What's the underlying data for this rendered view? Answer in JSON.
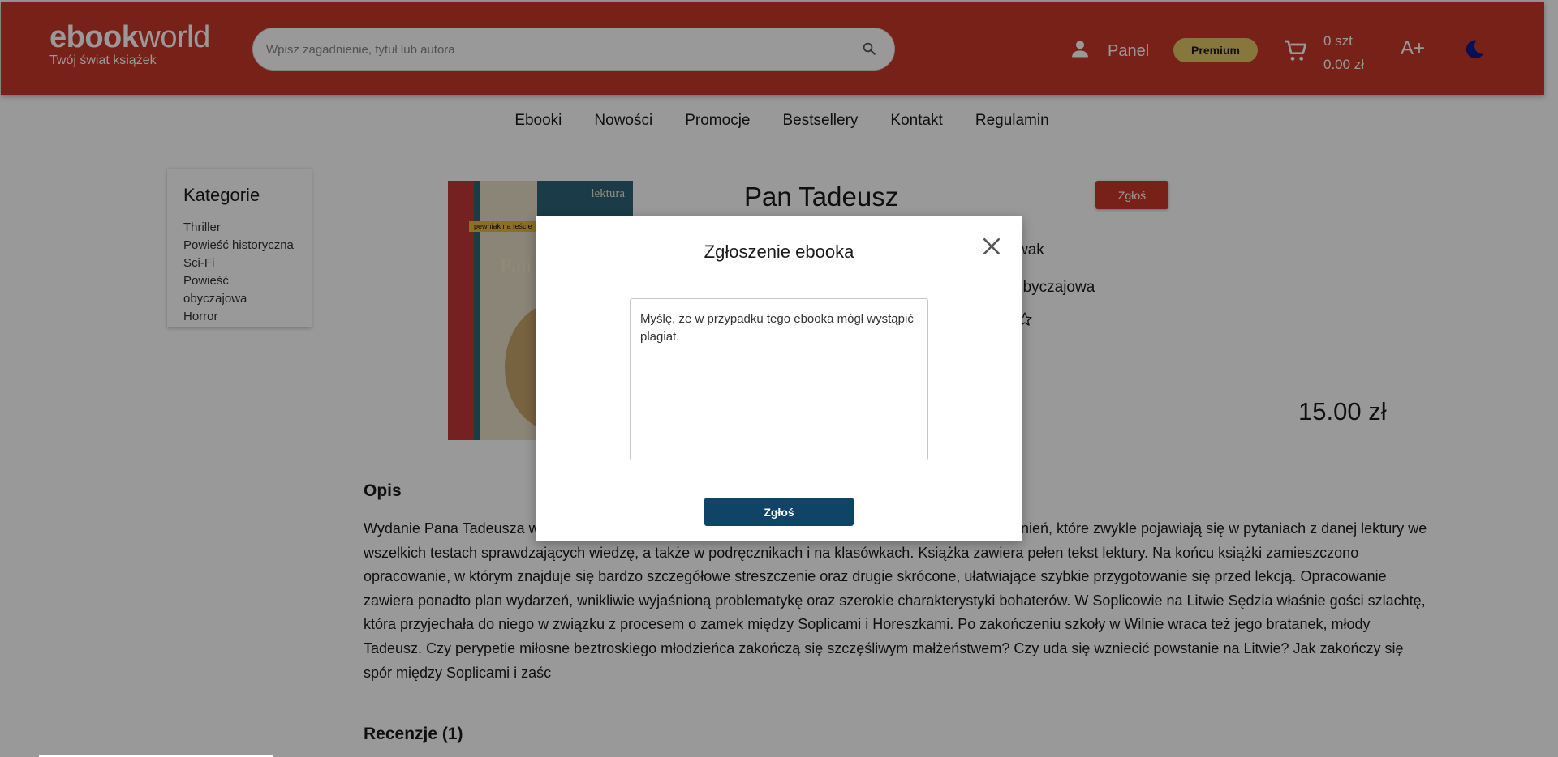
{
  "header": {
    "logo_bold": "ebook",
    "logo_light": "world",
    "tagline": "Twój świat książek",
    "search_placeholder": "Wpisz zagadnienie, tytuł lub autora",
    "panel_label": "Panel",
    "premium_label": "Premium",
    "cart_count": "0 szt",
    "cart_total": "0.00 zł",
    "font_size_label": "A+"
  },
  "nav": {
    "items": [
      "Ebooki",
      "Nowości",
      "Promocje",
      "Bestsellery",
      "Kontakt",
      "Regulamin"
    ]
  },
  "sidebar": {
    "title": "Kategorie",
    "items": [
      "Thriller",
      "Powieść historyczna",
      "Sci-Fi",
      "Powieść obyczajowa",
      "Horror"
    ]
  },
  "product": {
    "title": "Pan Tadeusz",
    "report_label": "Zgłoś",
    "author_partial": "wak",
    "category_partial": "obyczajowa",
    "price": "15.00 zł",
    "cover_label": "lektura",
    "cover_title": "Pan",
    "cover_badge": "pewniak na teście"
  },
  "description": {
    "heading": "Opis",
    "text": "Wydanie Pana Tadeusza wiedzi na pytania z podręcznika - pewniak na teście , czyli wskazanie zagadnień, które zwykle pojawiają się w pytaniach z danej lektury we wszelkich testach sprawdzających wiedzę, a także w podręcznikach i na klasówkach. Książka zawiera pełen tekst lektury. Na końcu książki zamieszczono opracowanie, w którym znajduje się bardzo szczegółowe streszczenie oraz drugie skrócone, ułatwiające szybkie przygotowanie się przed lekcją. Opracowanie zawiera ponadto plan wydarzeń, wnikliwie wyjaśnioną problematykę oraz szerokie charakterystyki bohaterów. W Soplicowie na Litwie Sędzia właśnie gości szlachtę, która przyjechała do niego w związku z procesem o zamek między Soplicami i Horeszkami. Po zakończeniu szkoły w Wilnie wraca też jego bratanek, młody Tadeusz. Czy perypetie miłosne beztroskiego młodzieńca zakończą się szczęśliwym małżeństwem? Czy uda się wzniecić powstanie na Litwie? Jak zakończy się spór między Soplicami i zaśc"
  },
  "reviews": {
    "heading": "Recenzje (1)"
  },
  "modal": {
    "title": "Zgłoszenie ebooka",
    "textarea_value": "Myślę, że w przypadku tego ebooka mógł wystąpić plagiat.",
    "submit_label": "Zgłoś"
  },
  "colors": {
    "header_bg": "#c8382a",
    "premium_bg": "#e3c766",
    "modal_button": "#0f4466",
    "moon": "#0d1b8c"
  },
  "icons": [
    "search-icon",
    "user-icon",
    "cart-icon",
    "moon-icon",
    "close-icon",
    "star-icon"
  ]
}
